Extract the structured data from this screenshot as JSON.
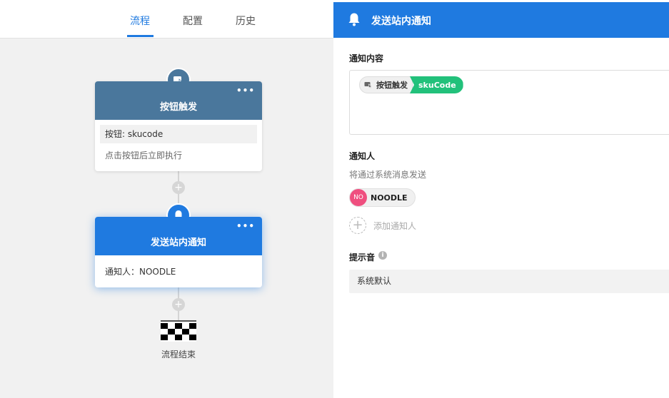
{
  "tabs": [
    {
      "label": "流程",
      "active": true
    },
    {
      "label": "配置",
      "active": false
    },
    {
      "label": "历史",
      "active": false
    }
  ],
  "flow": {
    "trigger_node": {
      "icon": "button-click-icon",
      "title": "按钮触发",
      "more": "•••",
      "button_line": "按钮: skucode",
      "description": "点击按钮后立即执行"
    },
    "notify_node": {
      "icon": "bell-icon",
      "title": "发送站内通知",
      "more": "•••",
      "recipient_line": "通知人：NOODLE"
    },
    "add_step_symbol": "+",
    "end_label": "流程结束"
  },
  "panel": {
    "title": "发送站内通知",
    "content_label": "通知内容",
    "content_chip": {
      "source": "按钮触发",
      "field": "skuCode"
    },
    "recipients_label": "通知人",
    "recipients_hint": "将通过系统消息发送",
    "recipient": {
      "avatar_text": "NO",
      "name": "NOODLE"
    },
    "add_recipient": "添加通知人",
    "sound_label": "提示音",
    "sound_value": "系统默认"
  },
  "colors": {
    "accent": "#1f7ae0",
    "trigger_node": "#4a779c",
    "field_chip": "#22c17b",
    "avatar": "#ef4f7f"
  }
}
